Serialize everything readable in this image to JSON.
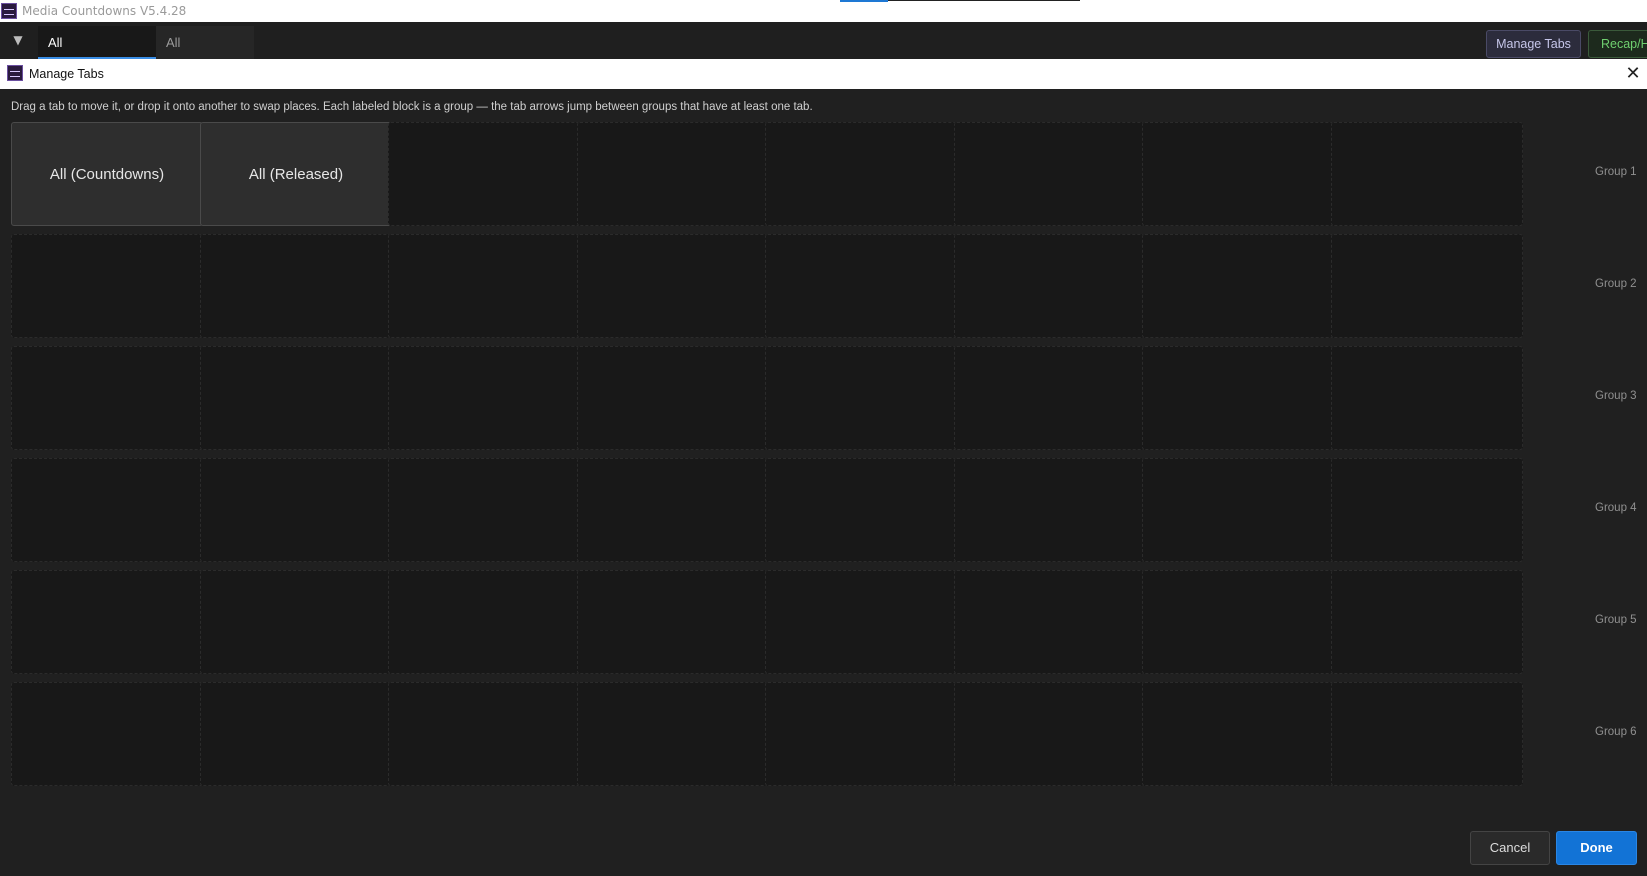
{
  "app": {
    "title": "Media Countdowns V5.4.28",
    "logo_icon": "app-logo-icon"
  },
  "tabbar": {
    "dropdown_glyph": "▼",
    "tabs": [
      {
        "label": "All (Countdowns)",
        "active": true
      },
      {
        "label": "All (Released)",
        "active": false
      }
    ],
    "manage_tabs_label": "Manage Tabs",
    "recap_label": "Recap/H"
  },
  "dialog": {
    "title": "Manage Tabs",
    "close_glyph": "✕",
    "instructions": "Drag a tab to move it, or drop it onto another to swap places. Each labeled block is a group — the tab arrows jump between groups that have at least one tab.",
    "groups": [
      {
        "label": "Group 1",
        "slots": [
          "All (Countdowns)",
          "All (Released)",
          "",
          "",
          "",
          "",
          "",
          ""
        ]
      },
      {
        "label": "Group 2",
        "slots": [
          "",
          "",
          "",
          "",
          "",
          "",
          "",
          ""
        ]
      },
      {
        "label": "Group 3",
        "slots": [
          "",
          "",
          "",
          "",
          "",
          "",
          "",
          ""
        ]
      },
      {
        "label": "Group 4",
        "slots": [
          "",
          "",
          "",
          "",
          "",
          "",
          "",
          ""
        ]
      },
      {
        "label": "Group 5",
        "slots": [
          "",
          "",
          "",
          "",
          "",
          "",
          "",
          ""
        ]
      },
      {
        "label": "Group 6",
        "slots": [
          "",
          "",
          "",
          "",
          "",
          "",
          "",
          ""
        ]
      }
    ],
    "cancel_label": "Cancel",
    "done_label": "Done"
  },
  "colors": {
    "accent": "#1273d6",
    "recap_text": "#6fcf6f",
    "manage_text": "#c6c6ea"
  }
}
